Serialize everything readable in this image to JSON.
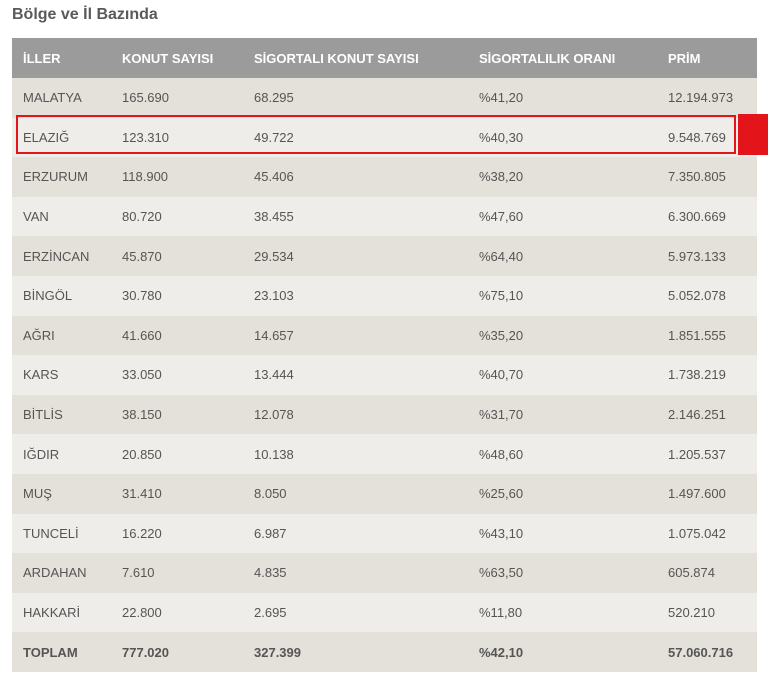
{
  "title": "Bölge ve İl Bazında",
  "colors": {
    "header_bg": "#9b9b9b",
    "row_odd": "#e3e1d9",
    "row_even": "#efedea",
    "highlight": "#e4141b"
  },
  "table": {
    "headers": [
      "İLLER",
      "KONUT SAYISI",
      "SİGORTALI KONUT SAYISI",
      "SİGORTALILIK ORANI",
      "PRİM"
    ],
    "rows": [
      [
        "MALATYA",
        "165.690",
        "68.295",
        "%41,20",
        "12.194.973"
      ],
      [
        "ELAZIĞ",
        "123.310",
        "49.722",
        "%40,30",
        "9.548.769"
      ],
      [
        "ERZURUM",
        "118.900",
        "45.406",
        "%38,20",
        "7.350.805"
      ],
      [
        "VAN",
        "80.720",
        "38.455",
        "%47,60",
        "6.300.669"
      ],
      [
        "ERZİNCAN",
        "45.870",
        "29.534",
        "%64,40",
        "5.973.133"
      ],
      [
        "BİNGÖL",
        "30.780",
        "23.103",
        "%75,10",
        "5.052.078"
      ],
      [
        "AĞRI",
        "41.660",
        "14.657",
        "%35,20",
        "1.851.555"
      ],
      [
        "KARS",
        "33.050",
        "13.444",
        "%40,70",
        "1.738.219"
      ],
      [
        "BİTLİS",
        "38.150",
        "12.078",
        "%31,70",
        "2.146.251"
      ],
      [
        "IĞDIR",
        "20.850",
        "10.138",
        "%48,60",
        "1.205.537"
      ],
      [
        "MUŞ",
        "31.410",
        "8.050",
        "%25,60",
        "1.497.600"
      ],
      [
        "TUNCELİ",
        "16.220",
        "6.987",
        "%43,10",
        "1.075.042"
      ],
      [
        "ARDAHAN",
        "7.610",
        "4.835",
        "%63,50",
        "605.874"
      ],
      [
        "HAKKARİ",
        "22.800",
        "2.695",
        "%11,80",
        "520.210"
      ],
      [
        "TOPLAM",
        "777.020",
        "327.399",
        "%42,10",
        "57.060.716"
      ]
    ],
    "highlighted_row": "ELAZIĞ"
  }
}
